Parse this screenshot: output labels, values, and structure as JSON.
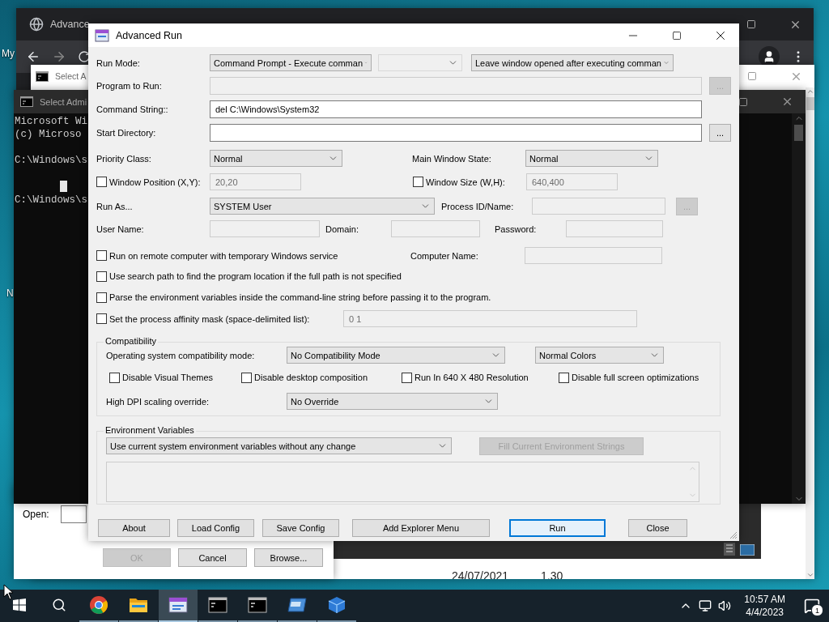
{
  "desktop": {
    "labels": [
      "My",
      "N"
    ]
  },
  "browser": {
    "tab_title": "Advance"
  },
  "back_window": {
    "title": "Select A",
    "row": [
      "24/07/2021",
      "1.30"
    ]
  },
  "run_dialog": {
    "open_label": "Open:",
    "buttons": [
      {
        "label": "OK",
        "disabled": true
      },
      {
        "label": "Cancel",
        "disabled": false
      },
      {
        "label": "Browse...",
        "disabled": false
      }
    ]
  },
  "console": {
    "title": "Select Admi",
    "lines": [
      "Microsoft Wi",
      "(c) Microso",
      "C:\\Windows\\s",
      "C:\\Windows\\s"
    ]
  },
  "dialog": {
    "title": "Advanced Run",
    "run_mode": {
      "label": "Run Mode:",
      "mode": "Command Prompt - Execute comman",
      "option": "Leave window opened after executing comman"
    },
    "program": {
      "label": "Program to Run:",
      "disabled": true,
      "browse": {
        "label": "...",
        "disabled": true
      }
    },
    "command": {
      "label": "Command String::",
      "value": "del C:\\Windows\\System32",
      "disabled": false
    },
    "start_dir": {
      "label": "Start Directory:",
      "disabled": false,
      "browse": {
        "label": "...",
        "disabled": false
      }
    },
    "priority": {
      "label": "Priority Class:",
      "value": "Normal"
    },
    "window_state": {
      "label": "Main Window State:",
      "value": "Normal"
    },
    "window_position": {
      "label": "Window Position (X,Y):",
      "checked": false,
      "value": "20,20",
      "disabled": true
    },
    "window_size": {
      "label": "Window Size (W,H):",
      "checked": false,
      "value": "640,400",
      "disabled": true
    },
    "run_as": {
      "label": "Run As...",
      "value": "SYSTEM User"
    },
    "process": {
      "label": "Process ID/Name:",
      "disabled": true,
      "browse": {
        "label": "...",
        "disabled": true
      }
    },
    "user_name": {
      "label": "User Name:",
      "disabled": true
    },
    "domain": {
      "label": "Domain:",
      "disabled": true
    },
    "password": {
      "label": "Password:",
      "disabled": true
    },
    "options": [
      {
        "label": "Run on remote computer with temporary Windows service",
        "checked": false
      },
      {
        "label": "Use search path to find the program location if the full path is not specified",
        "checked": false
      },
      {
        "label": "Parse the environment variables inside the command-line string before passing it to the program.",
        "checked": false
      },
      {
        "label": "Set the process affinity mask (space-delimited list):",
        "checked": false,
        "value": "0 1",
        "disabled": true
      }
    ],
    "computer_name": {
      "label": "Computer Name:",
      "disabled": true
    },
    "compatibility": {
      "title": "Compatibility",
      "mode_label": "Operating system compatibility mode:",
      "mode": "No Compatibility Mode",
      "colors": "Normal Colors",
      "flags": [
        {
          "label": "Disable Visual Themes",
          "checked": false
        },
        {
          "label": "Disable desktop composition",
          "checked": false
        },
        {
          "label": "Run In 640 X 480 Resolution",
          "checked": false
        },
        {
          "label": "Disable full screen optimizations",
          "checked": false
        }
      ],
      "dpi_label": "High DPI scaling override:",
      "dpi": "No Override"
    },
    "environment": {
      "title": "Environment Variables",
      "mode": "Use current system environment variables without any change",
      "fill_button": {
        "label": "Fill Current Environment Strings",
        "disabled": true
      }
    },
    "buttons": [
      {
        "label": "About",
        "default": false
      },
      {
        "label": "Load Config",
        "default": false
      },
      {
        "label": "Save Config",
        "default": false
      },
      {
        "label": "Add Explorer Menu",
        "default": false
      },
      {
        "label": "Run",
        "default": true
      },
      {
        "label": "Close",
        "default": false
      }
    ]
  },
  "taskbar": {
    "apps": [
      {
        "kind": "browser",
        "running": true,
        "active": false
      },
      {
        "kind": "folder",
        "running": true,
        "active": false
      },
      {
        "kind": "advrun",
        "running": true,
        "active": true
      },
      {
        "kind": "console",
        "running": true,
        "active": false
      },
      {
        "kind": "console",
        "running": true,
        "active": false
      },
      {
        "kind": "window",
        "running": true,
        "active": false
      },
      {
        "kind": "cube",
        "running": true,
        "active": false
      }
    ],
    "time": "10:57 AM",
    "date": "4/4/2023",
    "notifications": "1"
  }
}
